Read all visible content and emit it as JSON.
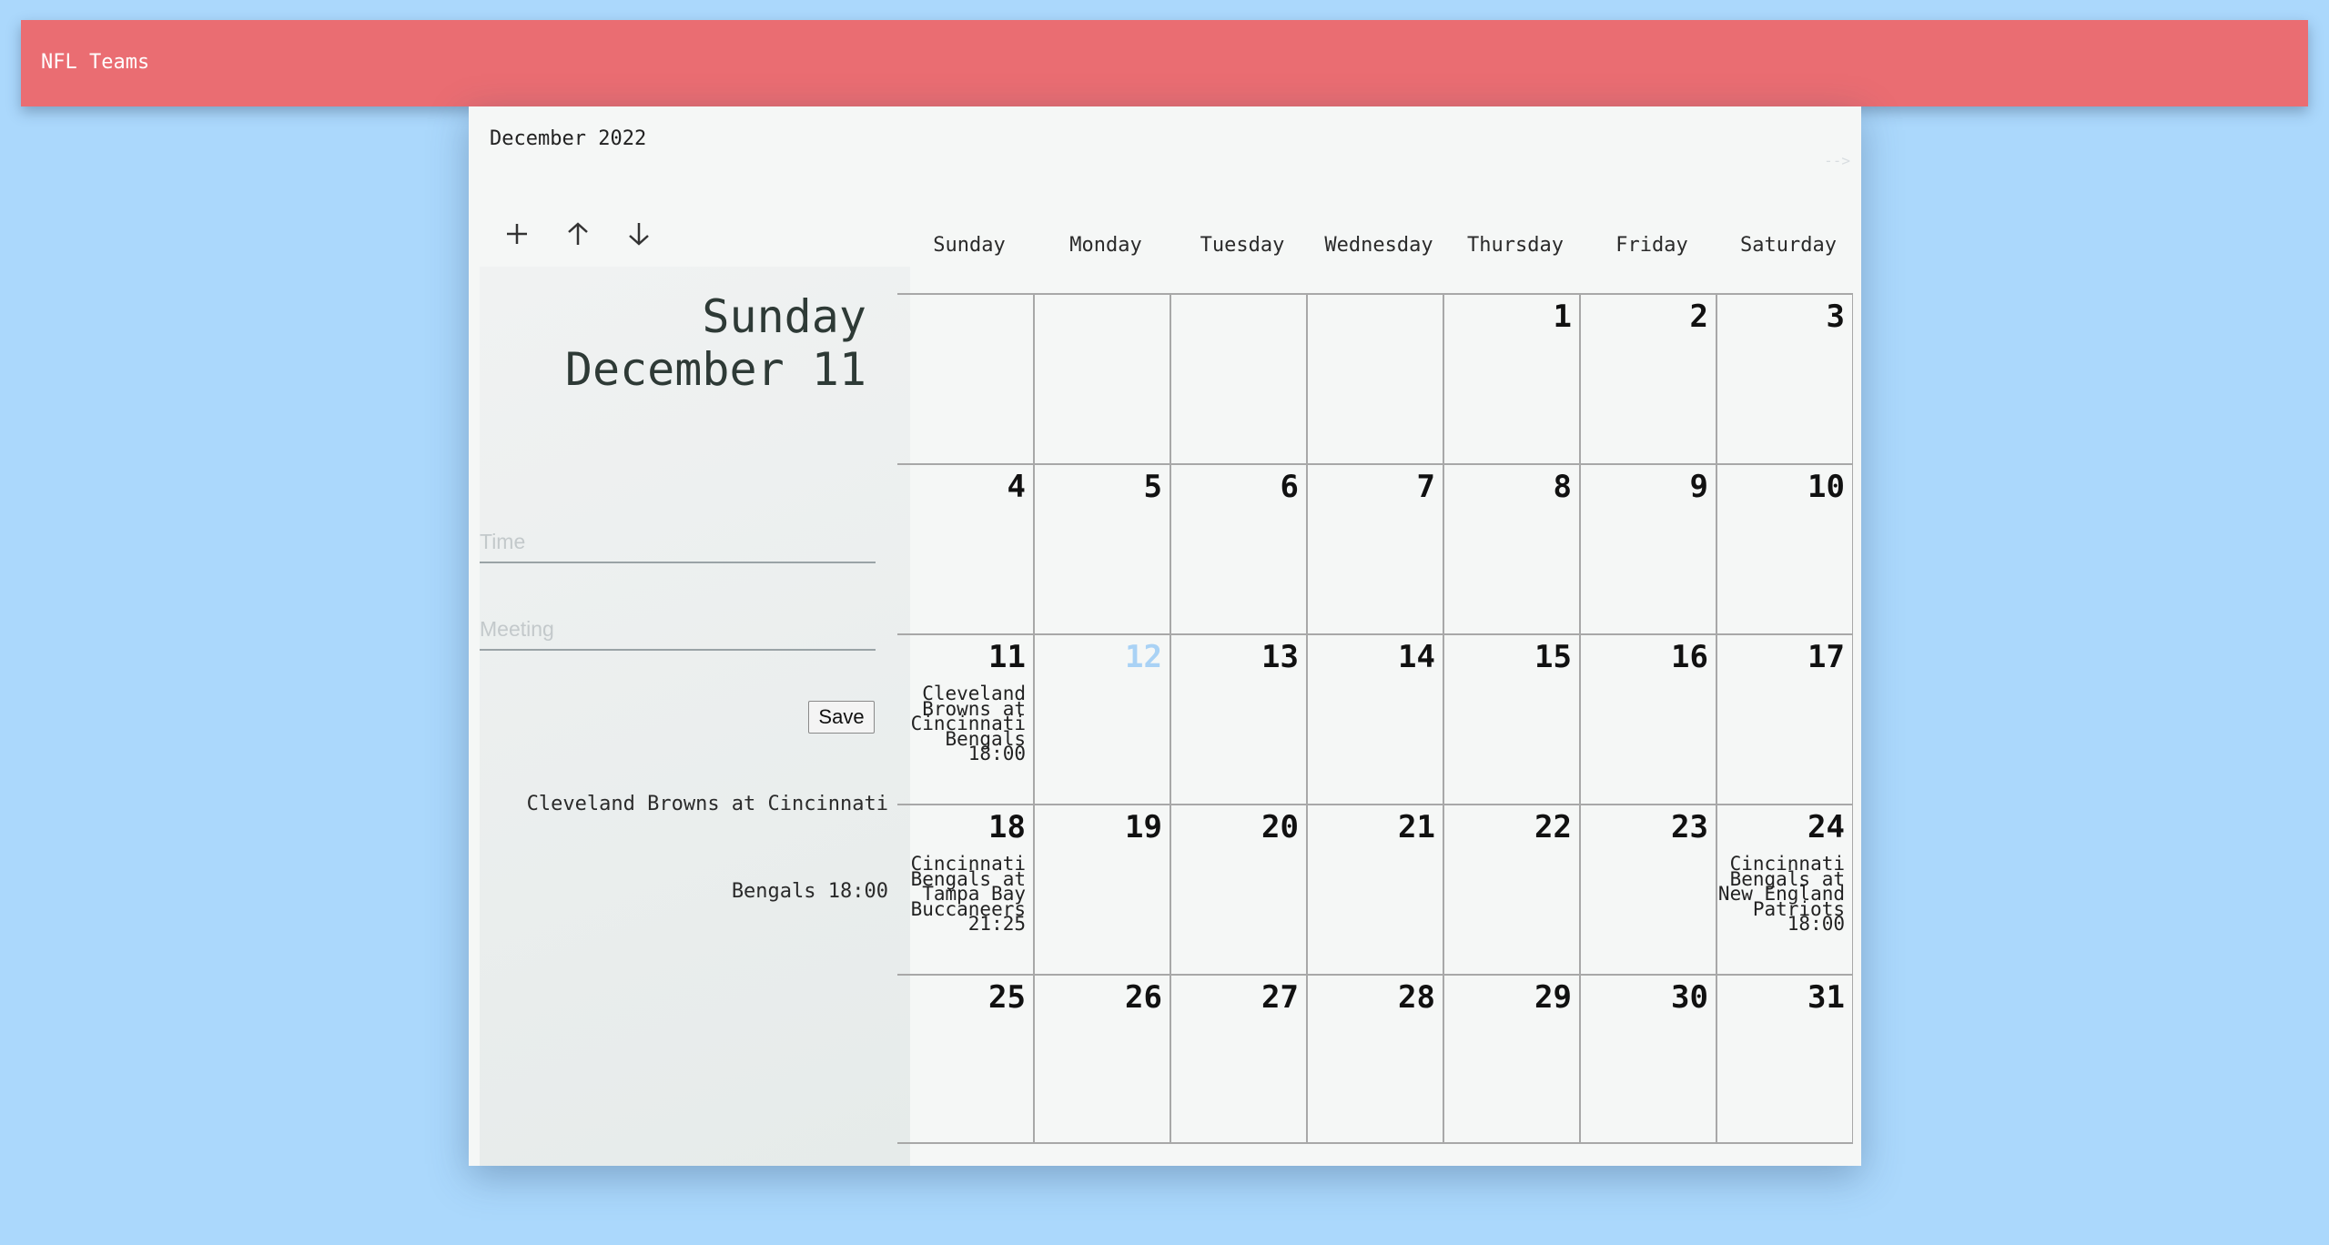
{
  "app": {
    "title": "NFL Teams"
  },
  "calendar": {
    "month_label": "December 2022",
    "next_label": "-->",
    "weekdays": [
      "Sunday",
      "Monday",
      "Tuesday",
      "Wednesday",
      "Thursday",
      "Friday",
      "Saturday"
    ],
    "weeks": [
      [
        {
          "day": "",
          "events": []
        },
        {
          "day": "",
          "events": []
        },
        {
          "day": "",
          "events": []
        },
        {
          "day": "",
          "events": []
        },
        {
          "day": "1",
          "events": []
        },
        {
          "day": "2",
          "events": []
        },
        {
          "day": "3",
          "events": []
        }
      ],
      [
        {
          "day": "4",
          "events": []
        },
        {
          "day": "5",
          "events": []
        },
        {
          "day": "6",
          "events": []
        },
        {
          "day": "7",
          "events": []
        },
        {
          "day": "8",
          "events": []
        },
        {
          "day": "9",
          "events": []
        },
        {
          "day": "10",
          "events": []
        }
      ],
      [
        {
          "day": "11",
          "events": [
            "Cleveland Browns at Cincinnati Bengals 18:00"
          ]
        },
        {
          "day": "12",
          "today": true,
          "events": []
        },
        {
          "day": "13",
          "events": []
        },
        {
          "day": "14",
          "events": []
        },
        {
          "day": "15",
          "events": []
        },
        {
          "day": "16",
          "events": []
        },
        {
          "day": "17",
          "events": []
        }
      ],
      [
        {
          "day": "18",
          "events": [
            "Cincinnati Bengals at Tampa Bay Buccaneers 21:25"
          ]
        },
        {
          "day": "19",
          "events": []
        },
        {
          "day": "20",
          "events": []
        },
        {
          "day": "21",
          "events": []
        },
        {
          "day": "22",
          "events": []
        },
        {
          "day": "23",
          "events": []
        },
        {
          "day": "24",
          "events": [
            "Cincinnati Bengals at New England Patriots 18:00"
          ]
        }
      ],
      [
        {
          "day": "25",
          "events": []
        },
        {
          "day": "26",
          "events": []
        },
        {
          "day": "27",
          "events": []
        },
        {
          "day": "28",
          "events": []
        },
        {
          "day": "29",
          "events": []
        },
        {
          "day": "30",
          "events": []
        },
        {
          "day": "31",
          "events": []
        }
      ]
    ]
  },
  "toolbar": {
    "add_icon": "plus-icon",
    "up_icon": "arrow-up-icon",
    "down_icon": "arrow-down-icon"
  },
  "sidebar": {
    "weekday": "Sunday",
    "date": "December 11",
    "time_placeholder": "Time",
    "meeting_placeholder": "Meeting",
    "save_label": "Save",
    "event_lines": [
      "Cleveland Browns at Cincinnati",
      "Bengals 18:00"
    ]
  },
  "colors": {
    "header_bg": "#ea6d72",
    "page_bg": "#abd8fc",
    "today": "#a9d2f5"
  }
}
